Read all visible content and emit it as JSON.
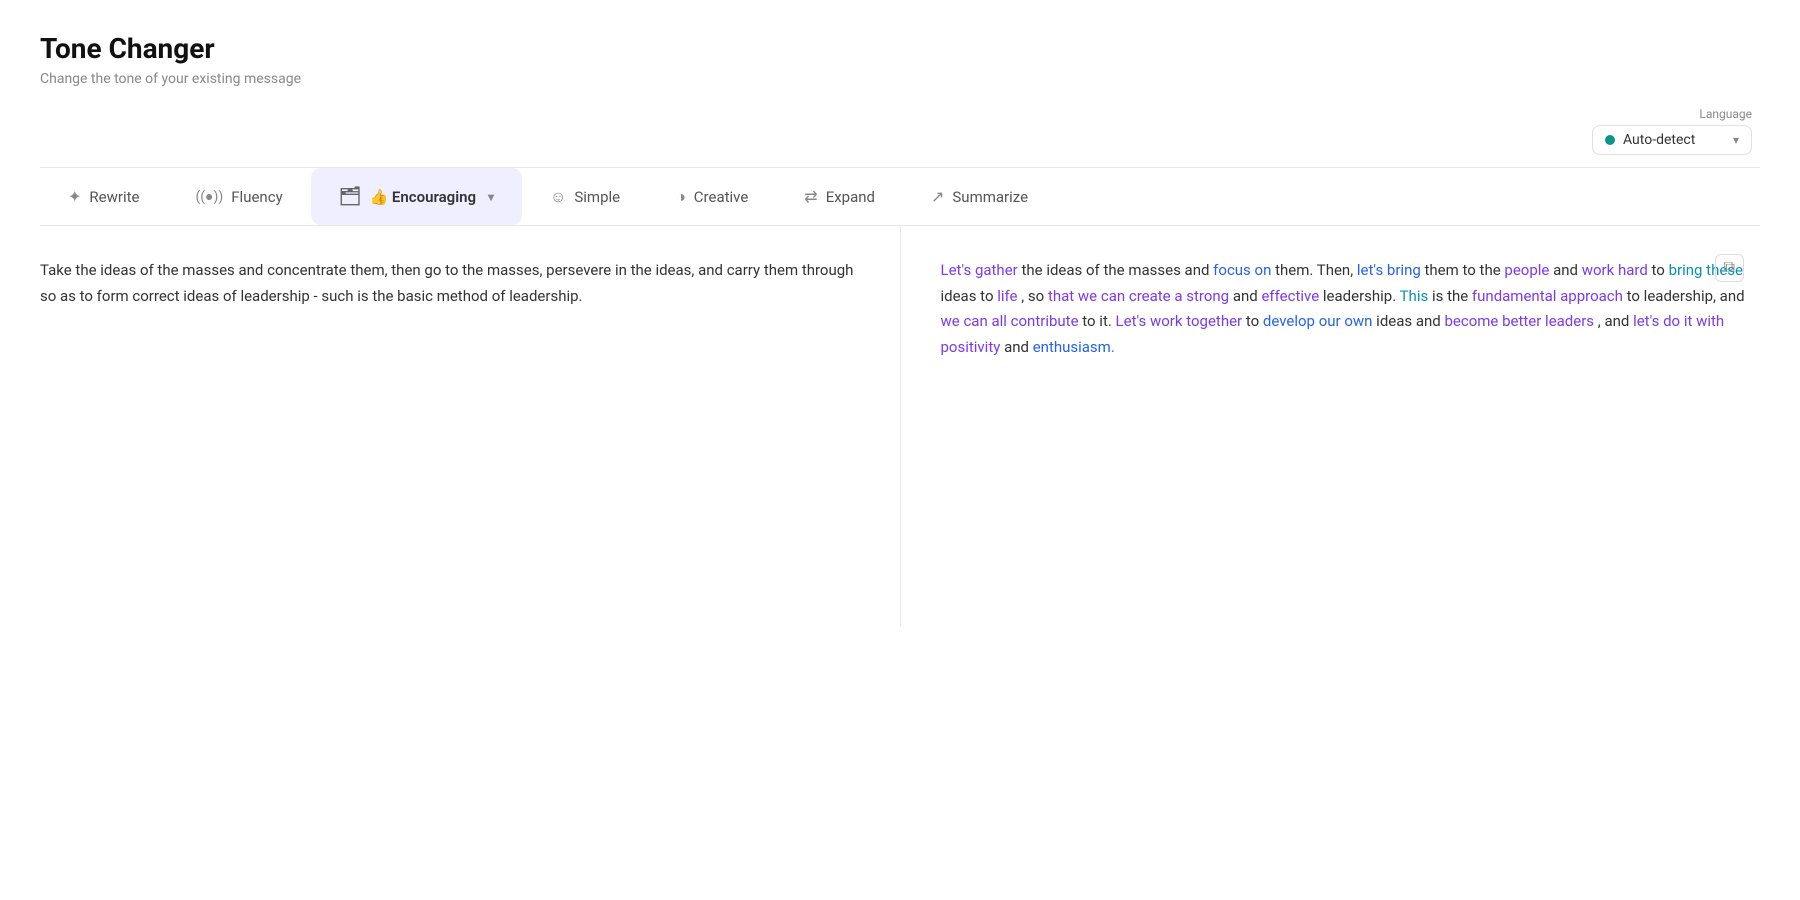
{
  "header": {
    "title": "Tone Changer",
    "subtitle": "Change the tone of your existing message"
  },
  "language": {
    "label": "Language",
    "selected": "Auto-detect",
    "dot_color": "#0d9488"
  },
  "toolbar": {
    "items": [
      {
        "id": "rewrite",
        "icon": "✦",
        "label": "Rewrite",
        "active": false
      },
      {
        "id": "fluency",
        "icon": "◎",
        "label": "Fluency",
        "active": false
      },
      {
        "id": "encouraging",
        "icon": "👍",
        "label": "Encouraging",
        "active": true,
        "has_chevron": true
      },
      {
        "id": "simple",
        "icon": "☺",
        "label": "Simple",
        "active": false
      },
      {
        "id": "creative",
        "icon": "◑",
        "label": "Creative",
        "active": false
      },
      {
        "id": "expand",
        "icon": "⇄",
        "label": "Expand",
        "active": false
      },
      {
        "id": "summarize",
        "icon": "↗",
        "label": "Summarize",
        "active": false
      }
    ]
  },
  "input_text": "Take the ideas of the masses and concentrate them, then go to the masses, persevere in the ideas, and carry them through so as to form correct ideas of leadership - such is the basic method of leadership.",
  "output": {
    "copy_icon": "⧉"
  }
}
